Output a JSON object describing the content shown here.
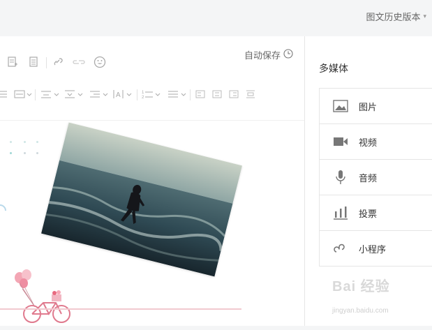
{
  "header": {
    "history_label": "图文历史版本",
    "history_caret": "▾"
  },
  "editor": {
    "autosave_label": "自动保存",
    "toolbar": {
      "row1": [
        "insert-doc-icon",
        "insert-page-icon",
        "link-icon",
        "unlink-icon",
        "emoji-icon"
      ],
      "row2": [
        "align-icon",
        "line-spacing-icon",
        "paragraph-before-icon",
        "paragraph-after-icon",
        "indent-icon",
        "letter-spacing-icon",
        "list-icon",
        "list-style-icon",
        "align-left-icon",
        "align-center-icon",
        "align-right-icon",
        "align-justify-icon"
      ]
    },
    "colors": {
      "toolbar_icon": "#aaaaaa",
      "pink_line": "#f2c9cf",
      "dot_teal": "#9fd7d5",
      "dot_gray": "#cfd8dc"
    }
  },
  "media_panel": {
    "title": "多媒体",
    "items": [
      {
        "label": "图片",
        "icon": "image-icon"
      },
      {
        "label": "视频",
        "icon": "video-icon"
      },
      {
        "label": "音频",
        "icon": "microphone-icon"
      },
      {
        "label": "投票",
        "icon": "poll-icon"
      },
      {
        "label": "小程序",
        "icon": "miniprogram-icon"
      }
    ]
  },
  "watermark": {
    "brand": "Bai 经验",
    "url": "jingyan.baidu.com"
  }
}
